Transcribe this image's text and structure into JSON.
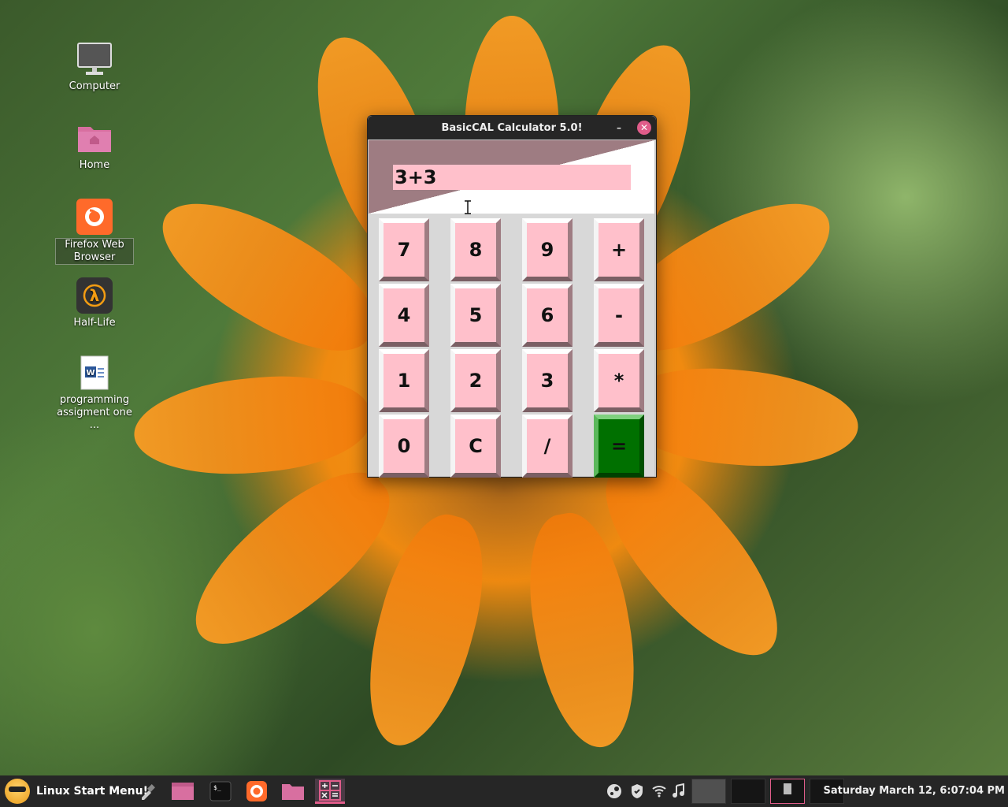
{
  "desktop": {
    "icons": [
      {
        "label": "Computer"
      },
      {
        "label": "Home"
      },
      {
        "label": "Firefox Web Browser"
      },
      {
        "label": "Half-Life"
      },
      {
        "label": "programming assigment one ..."
      }
    ]
  },
  "window": {
    "title": "BasicCAL Calculator 5.0!",
    "minimize_glyph": "–",
    "close_glyph": "✕",
    "display_value": "3+3",
    "keys": [
      "7",
      "8",
      "9",
      "+",
      "4",
      "5",
      "6",
      "-",
      "1",
      "2",
      "3",
      "*",
      "0",
      "C",
      "/",
      "="
    ]
  },
  "taskbar": {
    "start_label": "Linux Start Menu!",
    "clock": "Saturday March 12, 6:07:04 PM",
    "apps": [
      "eyedropper-icon",
      "folder-icon",
      "terminal-icon",
      "firefox-icon",
      "files-icon",
      "calculator-icon"
    ],
    "tray": [
      "steam-icon",
      "shield-icon",
      "wifi-icon",
      "music-icon"
    ]
  },
  "colors": {
    "accent": "#e05c8a",
    "key_bg": "#ffc0cb",
    "equals_bg": "#007000",
    "display_frame": "#9e7c82"
  }
}
